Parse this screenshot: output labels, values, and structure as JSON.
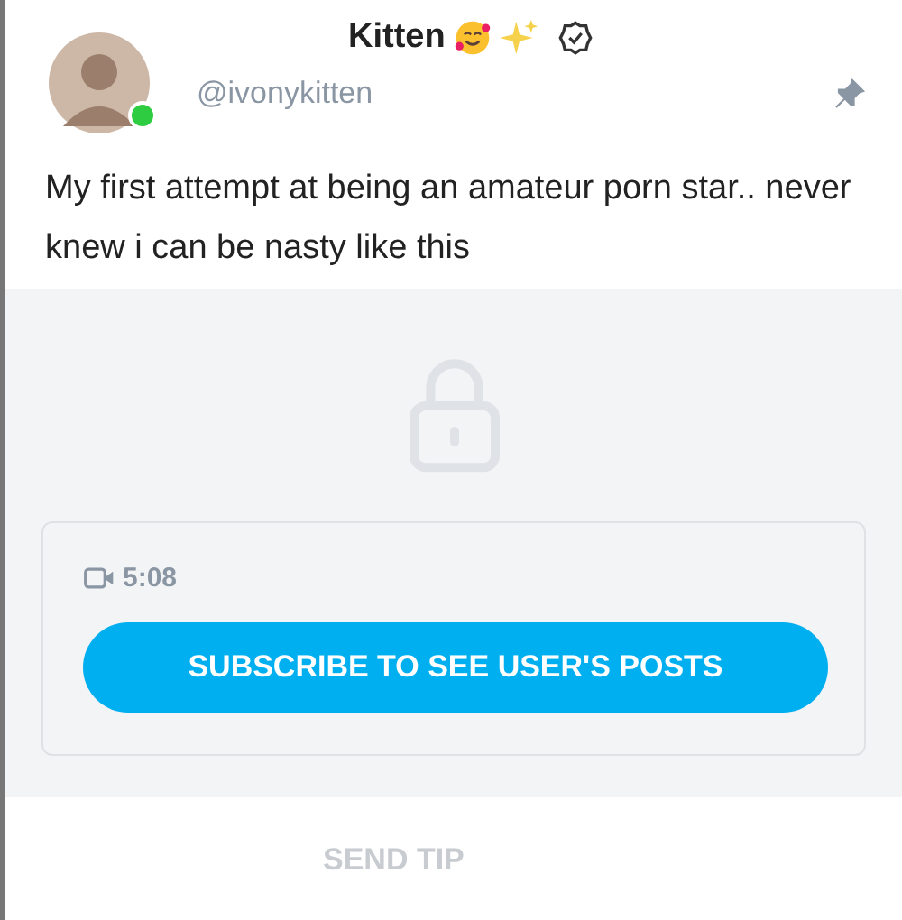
{
  "author": {
    "name": "Kitten",
    "handle": "@ivonykitten",
    "online": true,
    "verified": true,
    "pinned": true
  },
  "caption": "My first attempt at being an amateur porn star.. never knew i can be nasty like this",
  "locked": {
    "duration": "5:08",
    "subscribe_button": "SUBSCRIBE TO SEE USER'S POSTS"
  },
  "actions": [
    "SEND TIP"
  ]
}
